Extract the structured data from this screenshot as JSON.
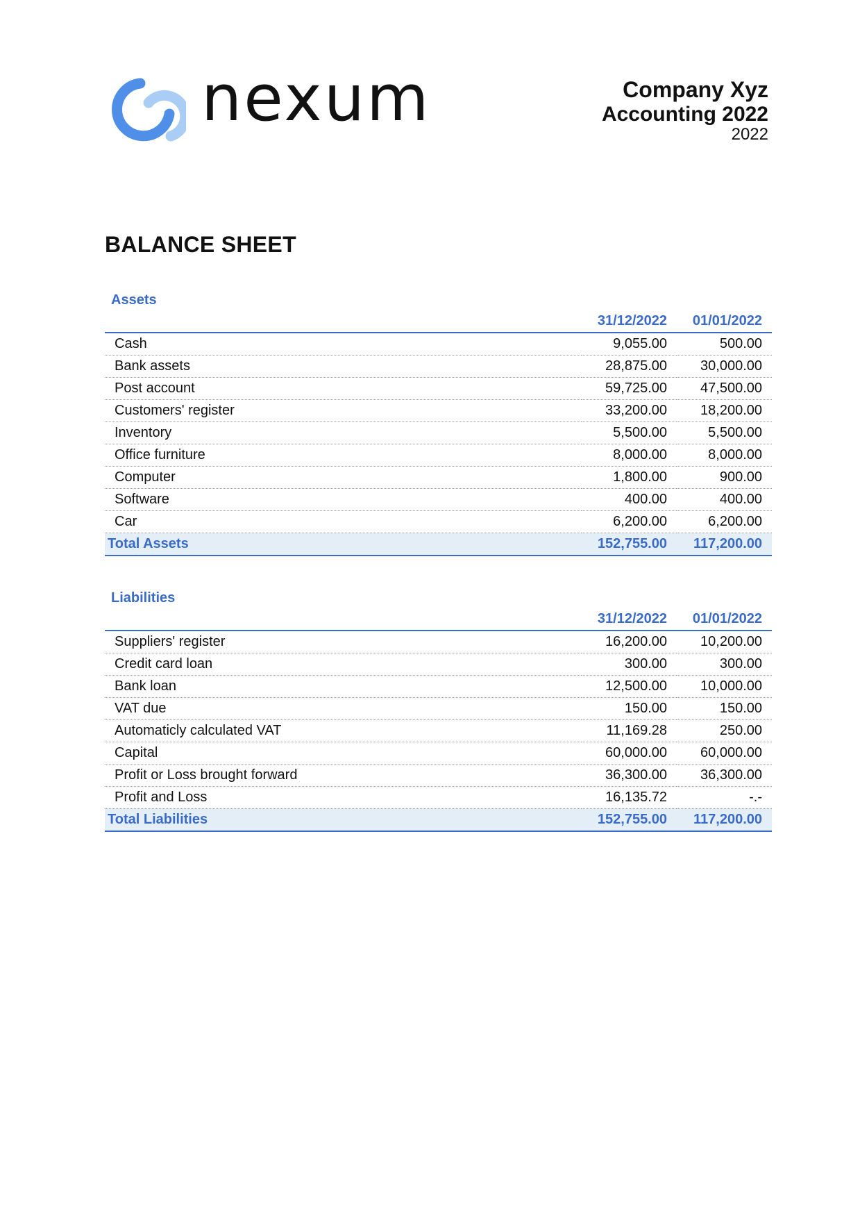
{
  "header": {
    "logo_text": "nexum",
    "company_name": "Company Xyz",
    "accounting_title": "Accounting 2022",
    "year": "2022"
  },
  "colors": {
    "accent": "#3a6bc7",
    "total_bg": "#e3eef7",
    "logo_blue_dark": "#4f8fe8",
    "logo_blue_light": "#a9cdf5"
  },
  "document": {
    "title": "BALANCE SHEET"
  },
  "assets": {
    "title": "Assets",
    "col1": "31/12/2022",
    "col2": "01/01/2022",
    "rows": [
      {
        "label": "Cash",
        "v1": "9,055.00",
        "v2": "500.00"
      },
      {
        "label": "Bank assets",
        "v1": "28,875.00",
        "v2": "30,000.00"
      },
      {
        "label": "Post account",
        "v1": "59,725.00",
        "v2": "47,500.00"
      },
      {
        "label": "Customers' register",
        "v1": "33,200.00",
        "v2": "18,200.00"
      },
      {
        "label": "Inventory",
        "v1": "5,500.00",
        "v2": "5,500.00"
      },
      {
        "label": "Office furniture",
        "v1": "8,000.00",
        "v2": "8,000.00"
      },
      {
        "label": "Computer",
        "v1": "1,800.00",
        "v2": "900.00"
      },
      {
        "label": "Software",
        "v1": "400.00",
        "v2": "400.00"
      },
      {
        "label": "Car",
        "v1": "6,200.00",
        "v2": "6,200.00"
      }
    ],
    "total": {
      "label": "Total Assets",
      "v1": "152,755.00",
      "v2": "117,200.00"
    }
  },
  "liabilities": {
    "title": "Liabilities",
    "col1": "31/12/2022",
    "col2": "01/01/2022",
    "rows": [
      {
        "label": "Suppliers' register",
        "v1": "16,200.00",
        "v2": "10,200.00"
      },
      {
        "label": "Credit card loan",
        "v1": "300.00",
        "v2": "300.00"
      },
      {
        "label": "Bank loan",
        "v1": "12,500.00",
        "v2": "10,000.00"
      },
      {
        "label": "VAT due",
        "v1": "150.00",
        "v2": "150.00"
      },
      {
        "label": "Automaticly calculated VAT",
        "v1": "11,169.28",
        "v2": "250.00"
      },
      {
        "label": "Capital",
        "v1": "60,000.00",
        "v2": "60,000.00"
      },
      {
        "label": "Profit or Loss brought forward",
        "v1": "36,300.00",
        "v2": "36,300.00"
      },
      {
        "label": "Profit and Loss",
        "v1": "16,135.72",
        "v2": "-.-"
      }
    ],
    "total": {
      "label": "Total Liabilities",
      "v1": "152,755.00",
      "v2": "117,200.00"
    }
  }
}
